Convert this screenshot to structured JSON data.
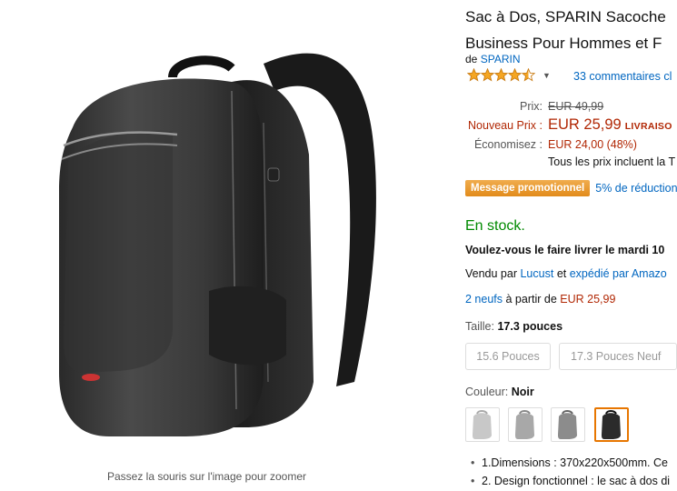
{
  "product": {
    "title_line1": "Sac à Dos, SPARIN Sacoche",
    "title_line2": "Business Pour Hommes et F",
    "brand_prefix": "de",
    "brand": "SPARIN"
  },
  "rating": {
    "stars": 4.5,
    "reviews_label": "33 commentaires cl"
  },
  "pricing": {
    "list_label": "Prix:",
    "list_price": "EUR 49,99",
    "new_label": "Nouveau Prix :",
    "new_price": "EUR 25,99",
    "delivery_badge": "LIVRAISO",
    "savings_label": "Économisez :",
    "savings_value": "EUR 24,00 (48%)",
    "tax_note": "Tous les prix incluent la T"
  },
  "promo": {
    "badge": "Message promotionnel",
    "text": "5% de réduction"
  },
  "availability": {
    "stock": "En stock.",
    "delivery": "Voulez-vous le faire livrer le mardi 10",
    "sold_by_prefix": "Vendu par",
    "seller": "Lucust",
    "and": "et",
    "shipped_by": "expédié par Amazo"
  },
  "offers": {
    "count_link": "2 neufs",
    "from_text": "à partir de",
    "from_price": "EUR 25,99"
  },
  "size": {
    "label": "Taille:",
    "selected": "17.3 pouces",
    "options": [
      "15.6 Pouces",
      "17.3 Pouces Neuf"
    ]
  },
  "color": {
    "label": "Couleur:",
    "selected": "Noir"
  },
  "bullets": [
    "1.Dimensions : 370x220x500mm. Ce",
    "2. Design fonctionnel : le sac à dos di"
  ],
  "image": {
    "zoom_hint": "Passez la souris sur l'image pour zoomer"
  },
  "colors": {
    "link": "#0066c0",
    "price_red": "#b12704",
    "stock_green": "#008a00",
    "promo_orange": "#e89b35",
    "selected_border": "#e77600"
  }
}
